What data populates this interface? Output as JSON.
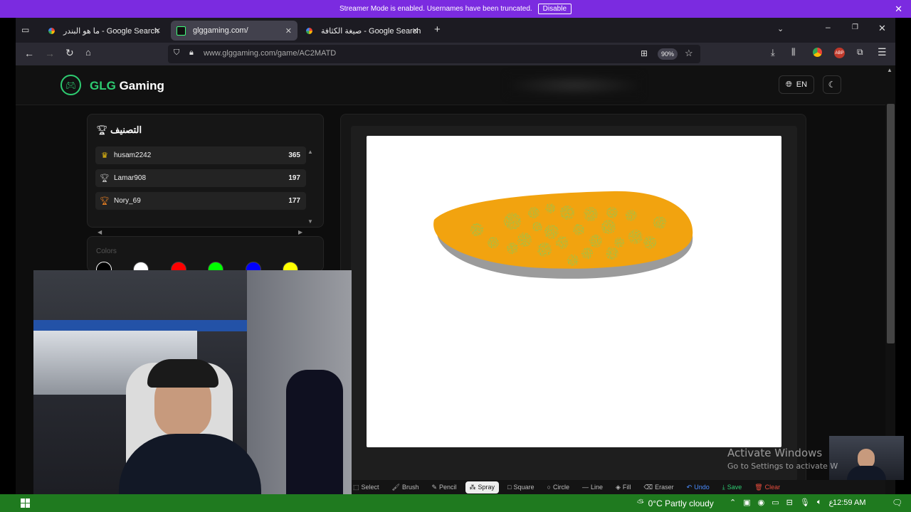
{
  "streamer_bar": {
    "message": "Streamer Mode is enabled. Usernames have been truncated.",
    "disable_label": "Disable"
  },
  "tabs": [
    {
      "title": "ما هو البندر - Google Search",
      "favicon": "google-icon",
      "active": false
    },
    {
      "title": "glggaming.com/",
      "favicon": "glg-icon",
      "active": true
    },
    {
      "title": "صيغة الكثافة - Google Search",
      "favicon": "google-icon",
      "active": false
    }
  ],
  "navbar": {
    "url": "www.glggaming.com/game/AC2MATD",
    "zoom": "90%"
  },
  "site": {
    "brand_green": "GLG",
    "brand_white": " Gaming",
    "lang": "EN"
  },
  "leaderboard": {
    "title": "التصنيف",
    "rows": [
      {
        "name": "husam2242",
        "score": "365",
        "rank_icon": "crown-icon"
      },
      {
        "name": "Lamar908",
        "score": "197",
        "rank_icon": "trophy-icon"
      },
      {
        "name": "Nory_69",
        "score": "177",
        "rank_icon": "trophy-icon"
      }
    ]
  },
  "colors_panel": {
    "label": "Colors",
    "swatches": [
      "#000000",
      "#ffffff",
      "#ff0000",
      "#00ff00",
      "#0000ff",
      "#ffff00"
    ]
  },
  "toolbar": {
    "tools": [
      {
        "label": "Select",
        "icon": "cursor-icon"
      },
      {
        "label": "Brush",
        "icon": "brush-icon"
      },
      {
        "label": "Pencil",
        "icon": "pencil-icon"
      },
      {
        "label": "Spray",
        "icon": "spray-icon",
        "active": true
      },
      {
        "label": "Square",
        "icon": "square-icon"
      },
      {
        "label": "Circle",
        "icon": "circle-icon"
      },
      {
        "label": "Line",
        "icon": "line-icon"
      },
      {
        "label": "Fill",
        "icon": "fill-icon"
      },
      {
        "label": "Eraser",
        "icon": "eraser-icon"
      },
      {
        "label": "Undo",
        "icon": "undo-icon"
      },
      {
        "label": "Save",
        "icon": "save-icon"
      },
      {
        "label": "Clear",
        "icon": "trash-icon"
      }
    ]
  },
  "activation": {
    "line1": "Activate Windows",
    "line2": "Go to Settings to activate W"
  },
  "taskbar": {
    "weather": "0°C  Partly cloudy",
    "lang_indicator": "ع",
    "time": "12:59 AM"
  },
  "colors": {
    "streamer_purple": "#7b2be0",
    "brand_green": "#2ecc71",
    "taskbar_green": "#1f7a1f",
    "drawing_orange": "#f2a30f",
    "drawing_spray": "#3a9a1a"
  }
}
